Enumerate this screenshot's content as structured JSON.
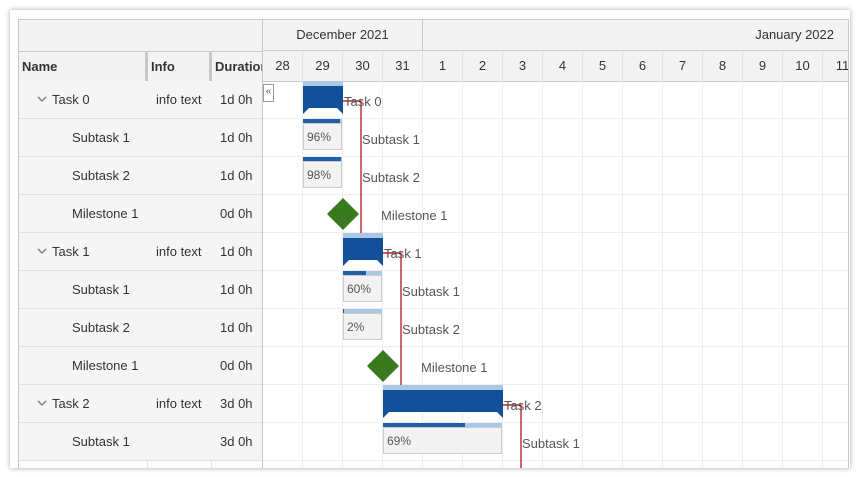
{
  "columns": {
    "name": "Name",
    "info": "Info",
    "duration": "Duration"
  },
  "timeline": {
    "months": [
      "December 2021",
      "January 2022"
    ],
    "days": [
      "28",
      "29",
      "30",
      "31",
      "1",
      "2",
      "3",
      "4",
      "5",
      "6",
      "7",
      "8",
      "9",
      "10",
      "11"
    ],
    "collapse_label": "«"
  },
  "rows": [
    {
      "name": "Task 0",
      "info": "info text",
      "duration": "1d 0h",
      "type": "task"
    },
    {
      "name": "Subtask 1",
      "info": "",
      "duration": "1d 0h",
      "type": "sub"
    },
    {
      "name": "Subtask 2",
      "info": "",
      "duration": "1d 0h",
      "type": "sub"
    },
    {
      "name": "Milestone 1",
      "info": "",
      "duration": "0d 0h",
      "type": "milestone"
    },
    {
      "name": "Task 1",
      "info": "info text",
      "duration": "1d 0h",
      "type": "task"
    },
    {
      "name": "Subtask 1",
      "info": "",
      "duration": "1d 0h",
      "type": "sub"
    },
    {
      "name": "Subtask 2",
      "info": "",
      "duration": "1d 0h",
      "type": "sub"
    },
    {
      "name": "Milestone 1",
      "info": "",
      "duration": "0d 0h",
      "type": "milestone"
    },
    {
      "name": "Task 2",
      "info": "info text",
      "duration": "3d 0h",
      "type": "task"
    },
    {
      "name": "Subtask 1",
      "info": "",
      "duration": "3d 0h",
      "type": "sub"
    }
  ],
  "bars": {
    "task0": {
      "label": "Task 0"
    },
    "t0s1": {
      "label": "Subtask 1",
      "percent": "96%",
      "progress": 0.96
    },
    "t0s2": {
      "label": "Subtask 2",
      "percent": "98%",
      "progress": 0.98
    },
    "m0": {
      "label": "Milestone 1"
    },
    "task1": {
      "label": "Task 1"
    },
    "t1s1": {
      "label": "Subtask 1",
      "percent": "60%",
      "progress": 0.6
    },
    "t1s2": {
      "label": "Subtask 2",
      "percent": "2%",
      "progress": 0.02
    },
    "m1": {
      "label": "Milestone 1"
    },
    "task2": {
      "label": "Task 2"
    },
    "t2s1": {
      "label": "Subtask 1",
      "percent": "69%",
      "progress": 0.69
    }
  },
  "colors": {
    "task_bar": "#13509a",
    "progress_track": "#a8c8e6",
    "progress_fill": "#1e5faa",
    "milestone": "#3a7a1e",
    "link": "#b00000"
  }
}
